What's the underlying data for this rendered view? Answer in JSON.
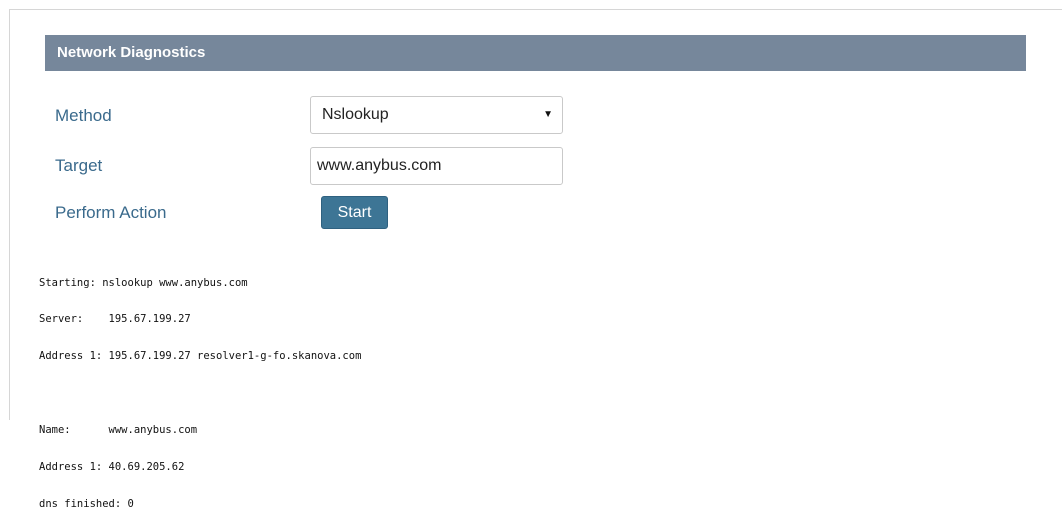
{
  "panel": {
    "title": "Network Diagnostics"
  },
  "form": {
    "method_label": "Method",
    "method_value": "Nslookup",
    "target_label": "Target",
    "target_value": "www.anybus.com",
    "action_label": "Perform Action",
    "start_label": "Start"
  },
  "output": {
    "lines": [
      "Starting: nslookup www.anybus.com",
      "Server:    195.67.199.27",
      "Address 1: 195.67.199.27 resolver1-g-fo.skanova.com",
      "",
      "Name:      www.anybus.com",
      "Address 1: 40.69.205.62",
      "dns finished: 0"
    ]
  },
  "colors": {
    "header_bg": "#76879b",
    "label_text": "#3a6a8c",
    "button_bg": "#3d7595"
  }
}
